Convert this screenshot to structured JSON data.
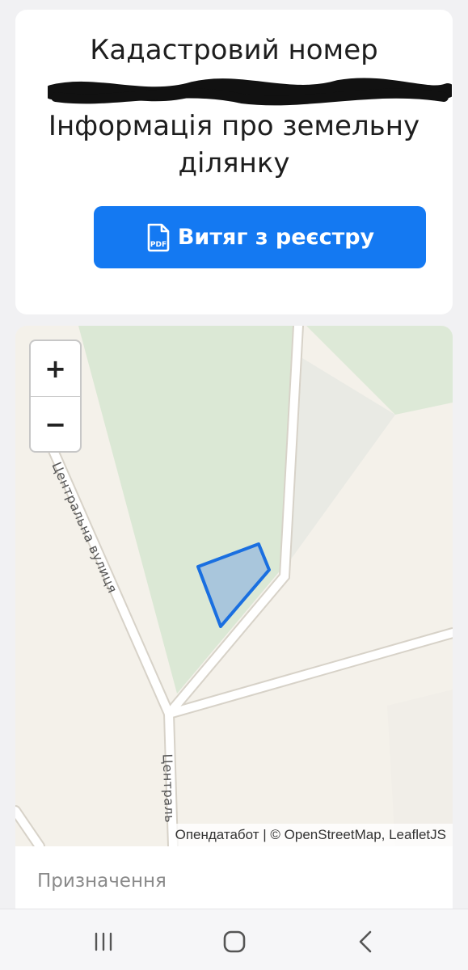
{
  "header": {
    "title_line1": "Кадастровий номер",
    "subtitle_line1": "Інформація про земельну",
    "subtitle_line2": "ділянку"
  },
  "actions": {
    "extract_button_label": "Витяг з реєстру",
    "extract_icon": "pdf-file-icon",
    "pdf_icon_text": "PDF"
  },
  "map": {
    "zoom_in_label": "+",
    "zoom_out_label": "−",
    "attribution": "Опендатабот | © OpenStreetMap, LeafletJS",
    "street_label_1": "Центральна вулиця",
    "street_label_2": "Централь"
  },
  "details": {
    "purpose_label": "Призначення"
  },
  "colors": {
    "accent": "#1479f2",
    "parcel_fill": "#a9c6dc",
    "parcel_stroke": "#1a6fe0",
    "green_area": "#dbe8d5"
  },
  "navigation": {
    "recent_icon": "recent-apps-icon",
    "home_icon": "home-icon",
    "back_icon": "back-icon"
  }
}
